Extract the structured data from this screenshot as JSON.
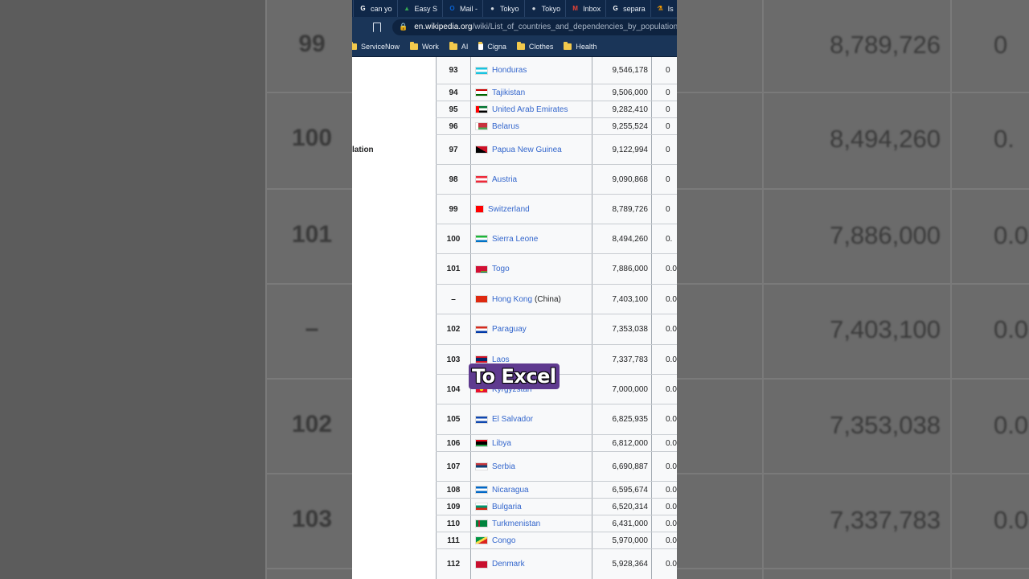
{
  "browser": {
    "tabs": [
      {
        "label": "can yo",
        "icon": "google-icon",
        "color": "#ffffff"
      },
      {
        "label": "Easy S",
        "icon": "drive-icon",
        "color": "#34a853"
      },
      {
        "label": "Mail -",
        "icon": "outlook-icon",
        "color": "#0a64d6"
      },
      {
        "label": "Tokyo",
        "icon": "github-icon",
        "color": "#d0d7de"
      },
      {
        "label": "Tokyo",
        "icon": "github-icon",
        "color": "#d0d7de"
      },
      {
        "label": "Inbox",
        "icon": "gmail-icon",
        "color": "#ea4335"
      },
      {
        "label": "separa",
        "icon": "google-icon",
        "color": "#ffffff"
      },
      {
        "label": "Is",
        "icon": "flask-icon",
        "color": "#f29900"
      }
    ],
    "url_host": "en.wikipedia.org",
    "url_path": "/wiki/List_of_countries_and_dependencies_by_population",
    "bookmarks": [
      {
        "label": "ServiceNow"
      },
      {
        "label": "Work"
      },
      {
        "label": "AI"
      },
      {
        "label": "Cigna"
      },
      {
        "label": "Clothes"
      },
      {
        "label": "Health"
      }
    ]
  },
  "page": {
    "left_label": "lation"
  },
  "table_rows": [
    {
      "rank": "93",
      "country": "Honduras",
      "suffix": "",
      "population": "9,546,178",
      "pct": "0",
      "flag": "honduras"
    },
    {
      "rank": "94",
      "country": "Tajikistan",
      "suffix": "",
      "population": "9,506,000",
      "pct": "0",
      "flag": "tajikistan"
    },
    {
      "rank": "95",
      "country": "United Arab Emirates",
      "suffix": "",
      "population": "9,282,410",
      "pct": "0",
      "flag": "uae"
    },
    {
      "rank": "96",
      "country": "Belarus",
      "suffix": "",
      "population": "9,255,524",
      "pct": "0",
      "flag": "belarus"
    },
    {
      "rank": "97",
      "country": "Papua New Guinea",
      "suffix": "",
      "population": "9,122,994",
      "pct": "0",
      "flag": "png"
    },
    {
      "rank": "98",
      "country": "Austria",
      "suffix": "",
      "population": "9,090,868",
      "pct": "0",
      "flag": "austria"
    },
    {
      "rank": "99",
      "country": "Switzerland",
      "suffix": "",
      "population": "8,789,726",
      "pct": "0",
      "flag": "switzerland"
    },
    {
      "rank": "100",
      "country": "Sierra Leone",
      "suffix": "",
      "population": "8,494,260",
      "pct": "0.",
      "flag": "sierra-leone"
    },
    {
      "rank": "101",
      "country": "Togo",
      "suffix": "",
      "population": "7,886,000",
      "pct": "0.0",
      "flag": "togo"
    },
    {
      "rank": "–",
      "country": "Hong Kong",
      "suffix": "(China)",
      "population": "7,403,100",
      "pct": "0.0",
      "flag": "hong-kong"
    },
    {
      "rank": "102",
      "country": "Paraguay",
      "suffix": "",
      "population": "7,353,038",
      "pct": "0.0",
      "flag": "paraguay"
    },
    {
      "rank": "103",
      "country": "Laos",
      "suffix": "",
      "population": "7,337,783",
      "pct": "0.0",
      "flag": "laos"
    },
    {
      "rank": "104",
      "country": "Kyrgyzstan",
      "suffix": "",
      "population": "7,000,000",
      "pct": "0.0",
      "flag": "kyrgyzstan"
    },
    {
      "rank": "105",
      "country": "El Salvador",
      "suffix": "",
      "population": "6,825,935",
      "pct": "0.0",
      "flag": "el-salvador"
    },
    {
      "rank": "106",
      "country": "Libya",
      "suffix": "",
      "population": "6,812,000",
      "pct": "0.0",
      "flag": "libya"
    },
    {
      "rank": "107",
      "country": "Serbia",
      "suffix": "",
      "population": "6,690,887",
      "pct": "0.0",
      "flag": "serbia"
    },
    {
      "rank": "108",
      "country": "Nicaragua",
      "suffix": "",
      "population": "6,595,674",
      "pct": "0.0",
      "flag": "nicaragua"
    },
    {
      "rank": "109",
      "country": "Bulgaria",
      "suffix": "",
      "population": "6,520,314",
      "pct": "0.0",
      "flag": "bulgaria"
    },
    {
      "rank": "110",
      "country": "Turkmenistan",
      "suffix": "",
      "population": "6,431,000",
      "pct": "0.0",
      "flag": "turkmenistan"
    },
    {
      "rank": "111",
      "country": "Congo",
      "suffix": "",
      "population": "5,970,000",
      "pct": "0.0",
      "flag": "congo"
    },
    {
      "rank": "112",
      "country": "Denmark",
      "suffix": "",
      "population": "5,928,364",
      "pct": "0.0",
      "flag": "denmark"
    }
  ],
  "background": {
    "rows": [
      {
        "rank": "99",
        "population": "8,789,726",
        "pct": "0"
      },
      {
        "rank": "100",
        "population": "8,494,260",
        "pct": "0."
      },
      {
        "rank": "101",
        "population": "7,886,000",
        "pct": "0.0"
      },
      {
        "rank": "–",
        "population": "7,403,100",
        "pct": "0.0"
      },
      {
        "rank": "102",
        "population": "7,353,038",
        "pct": "0.0"
      },
      {
        "rank": "103",
        "population": "7,337,783",
        "pct": "0.0"
      }
    ]
  },
  "caption": {
    "text": "To Excel"
  }
}
